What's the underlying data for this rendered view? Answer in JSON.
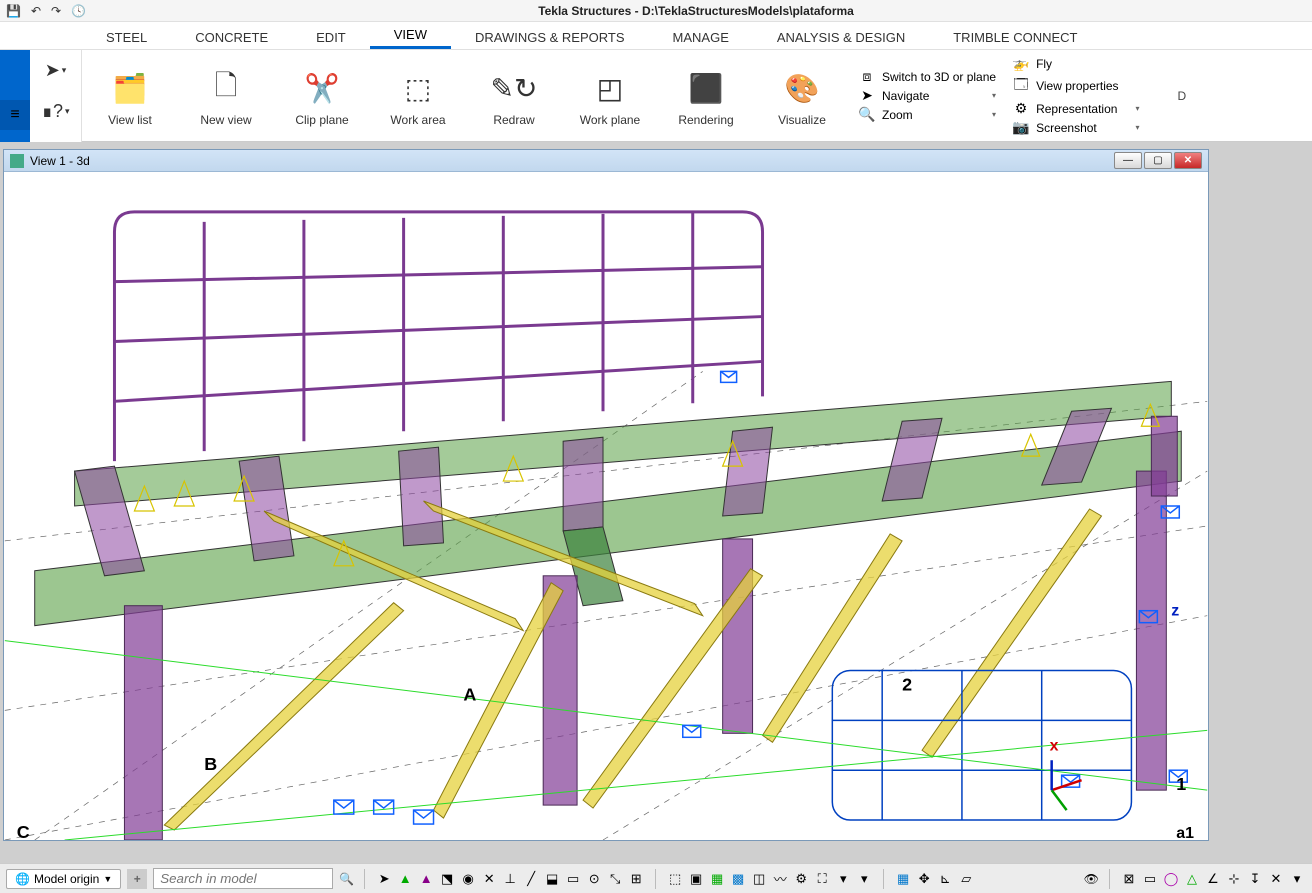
{
  "title": "Tekla Structures - D:\\TeklaStructuresModels\\plataforma",
  "qat": {
    "save": "💾",
    "undo": "↶",
    "redo": "↷",
    "history": "🕓"
  },
  "menu": {
    "items": [
      "STEEL",
      "CONCRETE",
      "EDIT",
      "VIEW",
      "DRAWINGS & REPORTS",
      "MANAGE",
      "ANALYSIS & DESIGN",
      "TRIMBLE CONNECT"
    ],
    "active": "VIEW"
  },
  "ribbon": {
    "buttons": {
      "view_list": "View list",
      "new_view": "New view",
      "clip_plane": "Clip plane",
      "work_area": "Work area",
      "redraw": "Redraw",
      "work_plane": "Work plane",
      "rendering": "Rendering",
      "visualize": "Visualize"
    },
    "list1": {
      "switch3d": "Switch to 3D or plane",
      "navigate": "Navigate",
      "zoom": "Zoom"
    },
    "list2": {
      "fly": "Fly",
      "view_properties": "View properties",
      "representation": "Representation",
      "screenshot": "Screenshot"
    },
    "extra": "D"
  },
  "viewwin": {
    "title": "View 1 - 3d"
  },
  "model": {
    "axes": {
      "x": "x",
      "y": "",
      "z": "z"
    },
    "grid_labels": {
      "A": "A",
      "B": "B",
      "C": "C",
      "one": "1",
      "two": "2",
      "a1": "a1"
    }
  },
  "status": {
    "origin_label": "Model origin",
    "search_placeholder": "Search in model"
  }
}
